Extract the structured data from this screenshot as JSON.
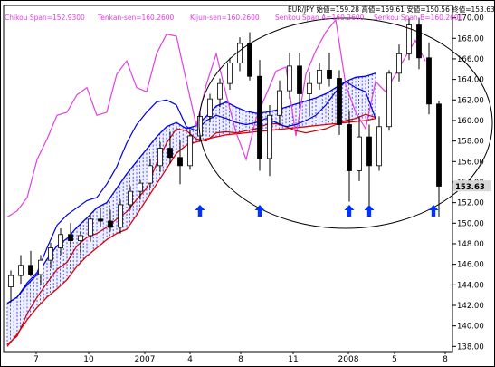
{
  "header": {
    "ohlc_label": "EUR/JPY 始値=159.28 高値=159.61 安値=150.56 終値=153.63",
    "chikou_label": "Chikou Span=152.9300",
    "tenkan_label": "Tenkan-sen=160.2600",
    "kijun_label": "Kijun-sen=160.2600",
    "senkou_a_label": "Senkou Span A=160.2600",
    "senkou_b_label": "Senkou Span B=160.2600"
  },
  "colors": {
    "chikou": "#e040e0",
    "tenkan": "#cc0000",
    "kijun": "#0000dd",
    "senkou_a": "#0000ee",
    "senkou_b": "#dd0000",
    "arrow": "#0033ff",
    "current_price_box": "#d8d8d8"
  },
  "chart_data": {
    "type": "line",
    "title": "",
    "xlabel": "",
    "ylabel": "",
    "ylim": [
      137.5,
      171.2
    ],
    "y_ticks": [
      "138.00",
      "140.00",
      "142.00",
      "144.00",
      "146.00",
      "148.00",
      "150.00",
      "152.00",
      "154.00",
      "156.00",
      "158.00",
      "160.00",
      "162.00",
      "164.00",
      "166.00",
      "168.00",
      "170.00"
    ],
    "x_tick_labels": [
      "7",
      "10",
      "2007",
      "4",
      "8",
      "11",
      "2008",
      "5",
      "8"
    ],
    "current_price_label": "153.63",
    "series": [
      {
        "name": "Chikou Span",
        "values": [
          150.6,
          151.2,
          152.5,
          156.2,
          158.2,
          160.5,
          160.8,
          162.5,
          163.2,
          160.5,
          160.8,
          164.5,
          165.8,
          163.2,
          162.8,
          166.5,
          168.4,
          168.2,
          163.8,
          159.5,
          163.5,
          166.5,
          162.5,
          158.8,
          156.2,
          160.2,
          162.5,
          164.8,
          165.2,
          158.5,
          164.5,
          166.8,
          168.6,
          169.8,
          163.5,
          160.8,
          159.2,
          163.8,
          162.8,
          164.5,
          166.2,
          167.8,
          165.8
        ]
      },
      {
        "name": "Tenkan-sen",
        "values": [
          138.2,
          139.0,
          141.2,
          142.8,
          144.2,
          145.5,
          146.2,
          147.8,
          148.6,
          149.0,
          149.6,
          150.4,
          151.1,
          152.3,
          153.4,
          155.8,
          157.8,
          159.2,
          159.0,
          158.2,
          158.0,
          158.8,
          158.9,
          158.8,
          159.0,
          159.2,
          159.6,
          159.7,
          159.4,
          159.0,
          158.8,
          159.0,
          159.2,
          159.6,
          160.0,
          160.2,
          160.6,
          160.3
        ]
      },
      {
        "name": "Kijun-sen",
        "values": [
          142.2,
          142.8,
          144.2,
          145.2,
          147.6,
          149.8,
          150.8,
          151.5,
          152.2,
          152.5,
          153.8,
          155.5,
          157.8,
          159.6,
          160.8,
          161.8,
          162.0,
          161.5,
          159.4,
          159.0,
          160.0,
          160.5,
          160.2,
          159.8,
          159.6,
          159.8,
          160.2,
          159.8,
          159.4,
          159.6,
          160.0,
          160.5,
          161.5,
          162.8,
          163.8,
          163.2,
          162.8,
          160.2
        ]
      }
    ],
    "candles": [
      {
        "o": 143.8,
        "h": 145.4,
        "l": 142.3,
        "c": 144.9
      },
      {
        "o": 144.9,
        "h": 146.9,
        "l": 144.1,
        "c": 145.9
      },
      {
        "o": 145.9,
        "h": 147.3,
        "l": 144.8,
        "c": 145.0
      },
      {
        "o": 145.0,
        "h": 146.9,
        "l": 144.0,
        "c": 146.4
      },
      {
        "o": 146.4,
        "h": 148.1,
        "l": 145.6,
        "c": 147.6
      },
      {
        "o": 147.6,
        "h": 149.5,
        "l": 146.9,
        "c": 148.9
      },
      {
        "o": 148.9,
        "h": 150.0,
        "l": 147.6,
        "c": 148.3
      },
      {
        "o": 148.3,
        "h": 149.2,
        "l": 147.1,
        "c": 148.8
      },
      {
        "o": 148.8,
        "h": 150.9,
        "l": 148.2,
        "c": 150.4
      },
      {
        "o": 150.4,
        "h": 151.5,
        "l": 149.6,
        "c": 150.2
      },
      {
        "o": 150.2,
        "h": 151.3,
        "l": 149.2,
        "c": 149.6
      },
      {
        "o": 149.6,
        "h": 152.3,
        "l": 149.0,
        "c": 151.8
      },
      {
        "o": 151.8,
        "h": 153.6,
        "l": 151.3,
        "c": 153.1
      },
      {
        "o": 153.1,
        "h": 154.2,
        "l": 152.3,
        "c": 153.9
      },
      {
        "o": 153.9,
        "h": 156.3,
        "l": 153.4,
        "c": 155.6
      },
      {
        "o": 155.6,
        "h": 157.9,
        "l": 155.0,
        "c": 157.3
      },
      {
        "o": 157.3,
        "h": 158.9,
        "l": 155.8,
        "c": 156.4
      },
      {
        "o": 156.4,
        "h": 158.1,
        "l": 153.8,
        "c": 155.6
      },
      {
        "o": 155.6,
        "h": 159.1,
        "l": 155.2,
        "c": 158.5
      },
      {
        "o": 158.5,
        "h": 160.9,
        "l": 157.9,
        "c": 160.4
      },
      {
        "o": 160.4,
        "h": 162.6,
        "l": 159.8,
        "c": 162.1
      },
      {
        "o": 162.1,
        "h": 164.1,
        "l": 161.3,
        "c": 163.6
      },
      {
        "o": 163.6,
        "h": 166.1,
        "l": 163.0,
        "c": 165.6
      },
      {
        "o": 165.6,
        "h": 168.1,
        "l": 164.8,
        "c": 167.5
      },
      {
        "o": 167.5,
        "h": 168.6,
        "l": 163.9,
        "c": 164.3
      },
      {
        "o": 164.3,
        "h": 165.9,
        "l": 155.1,
        "c": 156.3
      },
      {
        "o": 156.3,
        "h": 161.5,
        "l": 154.6,
        "c": 160.5
      },
      {
        "o": 160.5,
        "h": 163.9,
        "l": 159.5,
        "c": 162.9
      },
      {
        "o": 162.9,
        "h": 166.6,
        "l": 162.1,
        "c": 165.3
      },
      {
        "o": 165.3,
        "h": 166.6,
        "l": 161.3,
        "c": 162.6
      },
      {
        "o": 162.6,
        "h": 164.7,
        "l": 160.4,
        "c": 163.6
      },
      {
        "o": 163.6,
        "h": 165.6,
        "l": 163.0,
        "c": 164.9
      },
      {
        "o": 164.9,
        "h": 166.6,
        "l": 163.3,
        "c": 164.1
      },
      {
        "o": 164.1,
        "h": 164.9,
        "l": 158.6,
        "c": 159.6
      },
      {
        "o": 159.6,
        "h": 160.9,
        "l": 152.1,
        "c": 155.1
      },
      {
        "o": 155.1,
        "h": 160.4,
        "l": 154.1,
        "c": 158.4
      },
      {
        "o": 158.4,
        "h": 159.6,
        "l": 151.6,
        "c": 155.6
      },
      {
        "o": 155.6,
        "h": 160.4,
        "l": 155.1,
        "c": 159.4
      },
      {
        "o": 159.4,
        "h": 164.9,
        "l": 159.0,
        "c": 164.6
      },
      {
        "o": 164.6,
        "h": 167.4,
        "l": 163.8,
        "c": 166.5
      },
      {
        "o": 166.5,
        "h": 170.0,
        "l": 165.9,
        "c": 169.3
      },
      {
        "o": 169.3,
        "h": 170.0,
        "l": 165.0,
        "c": 166.1
      },
      {
        "o": 166.1,
        "h": 167.6,
        "l": 160.6,
        "c": 161.6
      },
      {
        "o": 161.6,
        "h": 161.9,
        "l": 150.6,
        "c": 153.6
      }
    ],
    "cloud_a": [
      142.2,
      142.8,
      144.0,
      145.0,
      146.5,
      147.8,
      148.5,
      149.6,
      150.5,
      151.5,
      152.0,
      153.4,
      154.8,
      156.0,
      157.2,
      158.4,
      159.4,
      159.8,
      159.2,
      159.5,
      160.4,
      161.4,
      161.8,
      161.3,
      160.9,
      160.7,
      160.8,
      161.0,
      161.3,
      161.6,
      161.9,
      162.2,
      162.6,
      163.2,
      163.8,
      164.2,
      164.3,
      164.6
    ],
    "cloud_b": [
      138.0,
      139.2,
      140.6,
      141.8,
      142.8,
      143.6,
      144.5,
      145.8,
      146.8,
      147.6,
      148.4,
      149.0,
      149.4,
      150.8,
      152.3,
      153.8,
      155.3,
      156.8,
      157.6,
      157.9,
      158.2,
      158.4,
      158.6,
      158.7,
      158.8,
      158.9,
      159.0,
      159.1,
      159.2,
      159.3,
      159.4,
      159.5,
      159.6,
      159.7,
      159.8,
      159.9,
      160.0,
      160.2
    ],
    "arrows_at_candle": [
      19,
      25,
      34,
      36,
      42
    ]
  }
}
